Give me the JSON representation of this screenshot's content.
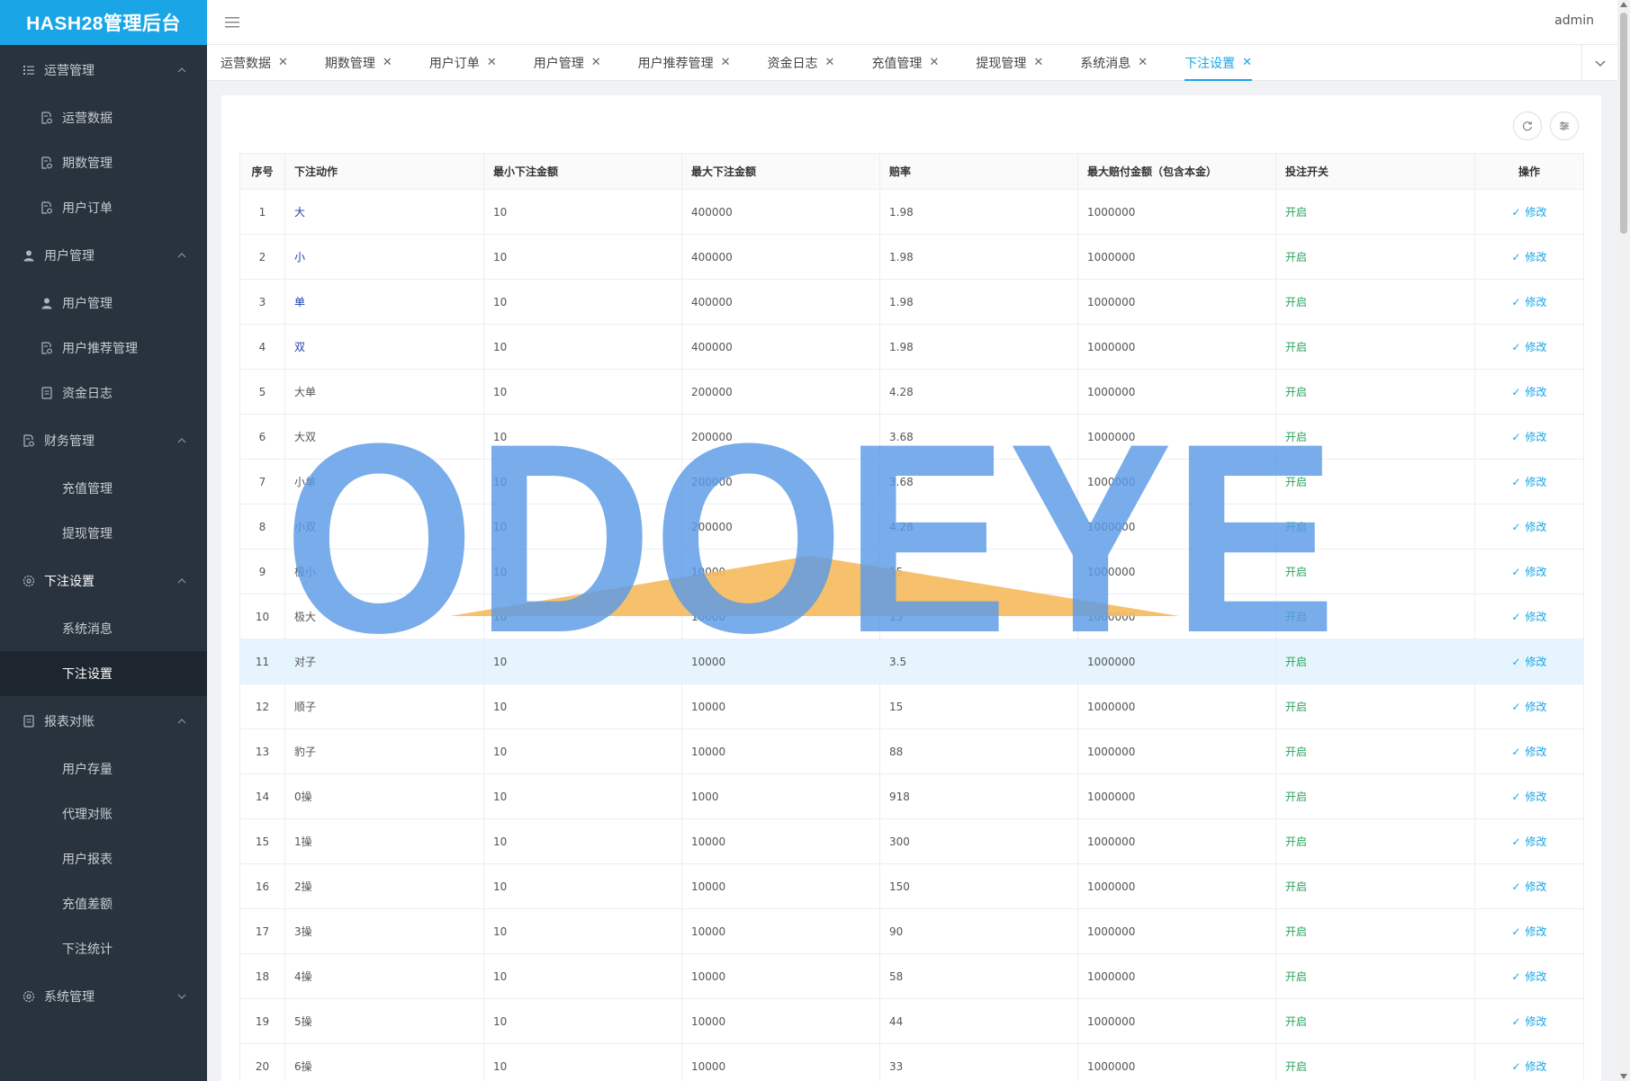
{
  "app": {
    "title": "HASH28管理后台",
    "user": "admin"
  },
  "sidebar": {
    "groups": [
      {
        "label": "运营管理",
        "icon": "list-icon",
        "open": true,
        "items": [
          {
            "label": "运营数据",
            "icon": "doc-gear-icon"
          },
          {
            "label": "期数管理",
            "icon": "doc-gear-icon"
          },
          {
            "label": "用户订单",
            "icon": "doc-gear-icon"
          }
        ]
      },
      {
        "label": "用户管理",
        "icon": "user-icon",
        "open": true,
        "items": [
          {
            "label": "用户管理",
            "icon": "user-icon"
          },
          {
            "label": "用户推荐管理",
            "icon": "doc-gear-icon"
          },
          {
            "label": "资金日志",
            "icon": "doc-icon"
          }
        ]
      },
      {
        "label": "财务管理",
        "icon": "doc-gear-icon",
        "open": true,
        "items": [
          {
            "label": "充值管理",
            "icon": ""
          },
          {
            "label": "提现管理",
            "icon": ""
          }
        ]
      },
      {
        "label": "下注设置",
        "icon": "gear-icon",
        "open": true,
        "items": [
          {
            "label": "系统消息",
            "icon": ""
          },
          {
            "label": "下注设置",
            "icon": "",
            "active": true
          }
        ]
      },
      {
        "label": "报表对账",
        "icon": "doc-icon",
        "open": true,
        "items": [
          {
            "label": "用户存量",
            "icon": ""
          },
          {
            "label": "代理对账",
            "icon": ""
          },
          {
            "label": "用户报表",
            "icon": ""
          },
          {
            "label": "充值差额",
            "icon": ""
          },
          {
            "label": "下注统计",
            "icon": ""
          }
        ]
      },
      {
        "label": "系统管理",
        "icon": "gear-icon",
        "open": false,
        "items": []
      }
    ]
  },
  "tabs": [
    {
      "label": "运营数据"
    },
    {
      "label": "期数管理"
    },
    {
      "label": "用户订单"
    },
    {
      "label": "用户管理"
    },
    {
      "label": "用户推荐管理"
    },
    {
      "label": "资金日志"
    },
    {
      "label": "充值管理"
    },
    {
      "label": "提现管理"
    },
    {
      "label": "系统消息"
    },
    {
      "label": "下注设置",
      "active": true
    }
  ],
  "table": {
    "headers": [
      "序号",
      "下注动作",
      "最小下注金额",
      "最大下注金额",
      "赔率",
      "最大赔付金额（包含本金）",
      "投注开关",
      "操作"
    ],
    "edit_label": "修改",
    "rows": [
      [
        "1",
        "大",
        "10",
        "400000",
        "1.98",
        "1000000",
        "开启"
      ],
      [
        "2",
        "小",
        "10",
        "400000",
        "1.98",
        "1000000",
        "开启"
      ],
      [
        "3",
        "单",
        "10",
        "400000",
        "1.98",
        "1000000",
        "开启"
      ],
      [
        "4",
        "双",
        "10",
        "400000",
        "1.98",
        "1000000",
        "开启"
      ],
      [
        "5",
        "大单",
        "10",
        "200000",
        "4.28",
        "1000000",
        "开启"
      ],
      [
        "6",
        "大双",
        "10",
        "200000",
        "3.68",
        "1000000",
        "开启"
      ],
      [
        "7",
        "小单",
        "10",
        "200000",
        "3.68",
        "1000000",
        "开启"
      ],
      [
        "8",
        "小双",
        "10",
        "200000",
        "4.28",
        "1000000",
        "开启"
      ],
      [
        "9",
        "极小",
        "10",
        "10000",
        "15",
        "1000000",
        "开启"
      ],
      [
        "10",
        "极大",
        "10",
        "10000",
        "15",
        "1000000",
        "开启"
      ],
      [
        "11",
        "对子",
        "10",
        "10000",
        "3.5",
        "1000000",
        "开启"
      ],
      [
        "12",
        "顺子",
        "10",
        "10000",
        "15",
        "1000000",
        "开启"
      ],
      [
        "13",
        "豹子",
        "10",
        "10000",
        "88",
        "1000000",
        "开启"
      ],
      [
        "14",
        "0操",
        "10",
        "1000",
        "918",
        "1000000",
        "开启"
      ],
      [
        "15",
        "1操",
        "10",
        "10000",
        "300",
        "1000000",
        "开启"
      ],
      [
        "16",
        "2操",
        "10",
        "10000",
        "150",
        "1000000",
        "开启"
      ],
      [
        "17",
        "3操",
        "10",
        "10000",
        "90",
        "1000000",
        "开启"
      ],
      [
        "18",
        "4操",
        "10",
        "10000",
        "58",
        "1000000",
        "开启"
      ],
      [
        "19",
        "5操",
        "10",
        "10000",
        "44",
        "1000000",
        "开启"
      ],
      [
        "20",
        "6操",
        "10",
        "10000",
        "33",
        "1000000",
        "开启"
      ]
    ],
    "highlight_row": "11",
    "blue_actions": [
      "大",
      "小",
      "单",
      "双"
    ]
  },
  "watermark": {
    "text": "ODOEYE",
    "color": "#5b9be6",
    "accent": "#f5b95c"
  },
  "colors": {
    "accent": "#1aa5e6",
    "sidebar": "#28333e",
    "on": "#27a35b"
  }
}
